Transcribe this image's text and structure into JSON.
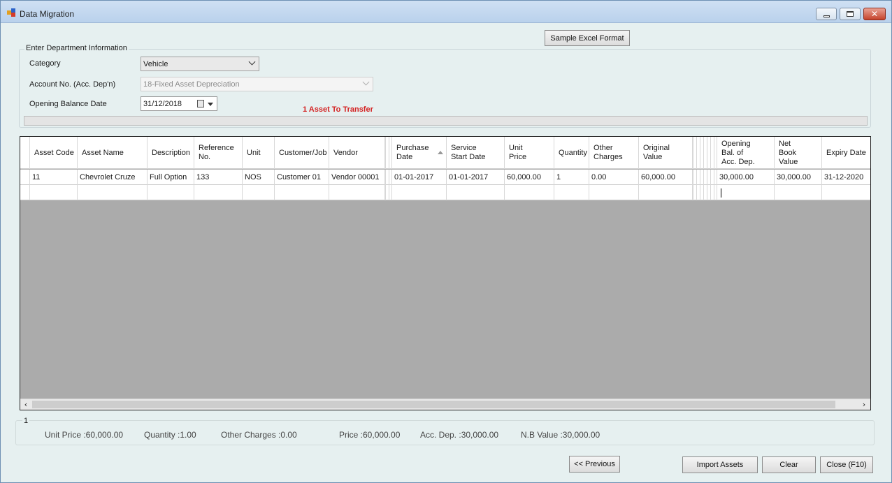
{
  "window": {
    "title": "Data Migration"
  },
  "toolbar": {
    "sample_excel_label": "Sample Excel Format"
  },
  "department": {
    "legend": "Enter Department Information",
    "category_label": "Category",
    "category_value": "Vehicle",
    "account_label": "Account No. (Acc. Dep'n)",
    "account_value": "18-Fixed Asset Depreciation",
    "opening_date_label": "Opening Balance Date",
    "opening_date_value": "31/12/2018",
    "transfer_message": "1 Asset To Transfer",
    "progress_fraction": 0
  },
  "grid": {
    "columns": [
      "Asset Code",
      "Asset Name",
      "Description",
      "Reference\nNo.",
      "Unit",
      "Customer/Job",
      "Vendor",
      "Purchase\nDate",
      "Service\nStart Date",
      "Unit\nPrice",
      "Quantity",
      "Other\nCharges",
      "Original\nValue",
      "Opening\nBal. of\nAcc. Dep.",
      "Net\nBook\nValue",
      "Expiry Date"
    ],
    "rows": [
      [
        "11",
        "Chevrolet Cruze",
        "Full Option",
        "133",
        "NOS",
        "Customer 01",
        "Vendor 00001",
        "01-01-2017",
        "01-01-2017",
        "60,000.00",
        "1",
        "0.00",
        "60,000.00",
        "30,000.00",
        "30,000.00",
        "31-12-2020"
      ]
    ]
  },
  "summary": {
    "record_count": "1",
    "unit_price": "Unit Price :60,000.00",
    "quantity": "Quantity :1.00",
    "other_charges": "Other Charges :0.00",
    "price": "Price :60,000.00",
    "acc_dep": "Acc. Dep. :30,000.00",
    "nb_value": "N.B Value :30,000.00"
  },
  "actions": {
    "previous_label": "<< Previous",
    "import_label": "Import Assets",
    "clear_label": "Clear",
    "close_label": "Close (F10)"
  },
  "colors": {
    "accent_red": "#d42020",
    "titlebar": "#c4d9f0"
  }
}
